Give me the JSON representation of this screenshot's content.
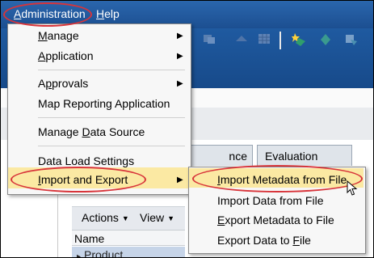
{
  "menubar": {
    "administration": {
      "pre": "",
      "u": "A",
      "post": "dministration"
    },
    "help": {
      "pre": "",
      "u": "H",
      "post": "elp"
    }
  },
  "admin_menu": {
    "manage": {
      "pre": "",
      "u": "M",
      "post": "anage"
    },
    "application": {
      "pre": "",
      "u": "A",
      "post": "pplication"
    },
    "approvals": {
      "pre": "A",
      "u": "p",
      "post": "provals"
    },
    "map_reporting": "Map Reporting Application",
    "manage_data_source": {
      "pre": "Manage ",
      "u": "D",
      "post": "ata Source"
    },
    "data_load_settings": "Data Load Settings",
    "import_export": {
      "pre": "",
      "u": "I",
      "post": "mport and Export"
    }
  },
  "import_export_submenu": {
    "import_metadata": {
      "pre": "",
      "u": "I",
      "post": "mport Metadata from File"
    },
    "import_data": "Import Data from File",
    "export_metadata": {
      "pre": "",
      "u": "E",
      "post": "xport Metadata to File"
    },
    "export_data": {
      "pre": "Export Data to ",
      "u": "F",
      "post": "ile"
    }
  },
  "tabs": {
    "inference_settings": "nce Settings",
    "evaluation_order": "Evaluation Order"
  },
  "action_bar": {
    "actions": "Actions",
    "view": "View"
  },
  "grid": {
    "header_name": "Name",
    "first_row": "Product"
  },
  "colors": {
    "menubar": "#1c4f91",
    "highlight": "#fbe9a3",
    "callout": "#d8343a"
  }
}
